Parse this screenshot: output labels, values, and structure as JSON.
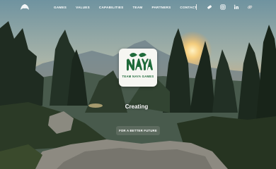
{
  "brand": {
    "name": "Team Naya Games",
    "logo_word": "NAYA",
    "logo_tagline": "TEAM NAYA GAMES"
  },
  "nav": {
    "items": [
      {
        "label": "GAMES"
      },
      {
        "label": "VALUES"
      },
      {
        "label": "CAPABILITIES"
      },
      {
        "label": "TEAM"
      },
      {
        "label": "PARTNERS"
      },
      {
        "label": "CONTACT"
      }
    ],
    "social_icons": [
      "game-controller-icon",
      "instagram-icon",
      "linkedin-icon",
      "link-icon"
    ]
  },
  "hero": {
    "headline": "Creating",
    "cta_label": "FOR A BETTER FUTURE"
  },
  "colors": {
    "brand_green": "#1f6a3a",
    "button_bg": "#5d6b5f",
    "sky_top": "#7fa3b0",
    "sun": "#f2a64a"
  }
}
